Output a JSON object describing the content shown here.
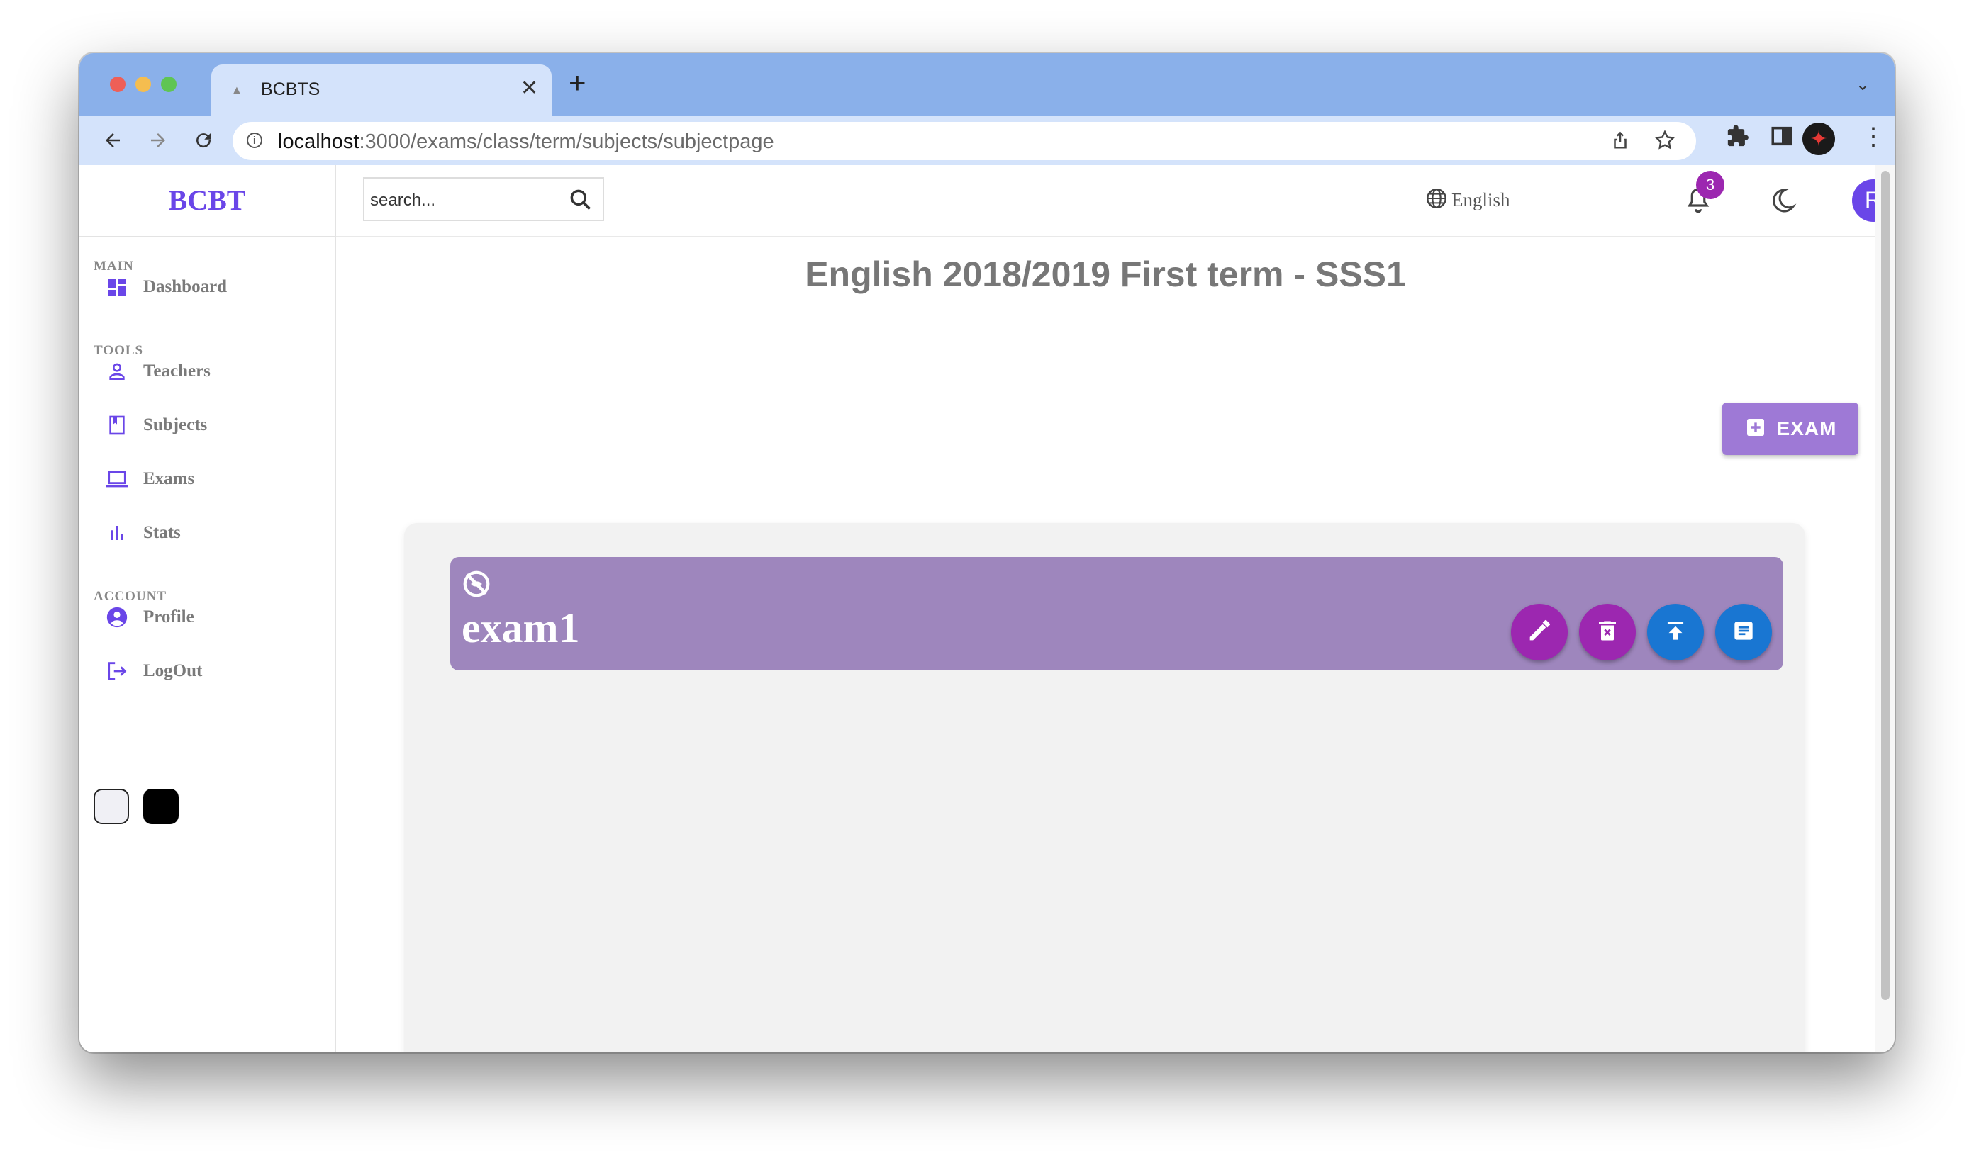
{
  "browser": {
    "tab_title": "BCBTS",
    "url_host": "localhost",
    "url_path": ":3000/exams/class/term/subjects/subjectpage"
  },
  "sidebar": {
    "logo": "BCBT",
    "sections": {
      "main": "MAIN",
      "tools": "TOOLS",
      "account": "ACCOUNT"
    },
    "items": [
      {
        "label": "Dashboard",
        "icon": "dashboard-icon"
      },
      {
        "label": "Teachers",
        "icon": "person-icon"
      },
      {
        "label": "Subjects",
        "icon": "book-icon"
      },
      {
        "label": "Exams",
        "icon": "laptop-icon"
      },
      {
        "label": "Stats",
        "icon": "bar-chart-icon"
      },
      {
        "label": "Profile",
        "icon": "account-circle-icon"
      },
      {
        "label": "LogOut",
        "icon": "logout-icon"
      }
    ],
    "themes": [
      "light",
      "dark"
    ]
  },
  "topbar": {
    "search_placeholder": "search...",
    "language": "English",
    "notifications": "3",
    "avatar_initial": "R"
  },
  "main": {
    "title": "English 2018/2019 First term - SSS1",
    "add_button": "EXAM",
    "exams": [
      {
        "name": "exam1",
        "actions": [
          "edit",
          "delete",
          "publish",
          "results"
        ]
      }
    ]
  },
  "colors": {
    "accent": "#6a46e8",
    "add_button": "#9e79d6",
    "exam_card": "#9e86bd",
    "fab_purple": "#9c27b0",
    "fab_blue": "#1976d2"
  }
}
